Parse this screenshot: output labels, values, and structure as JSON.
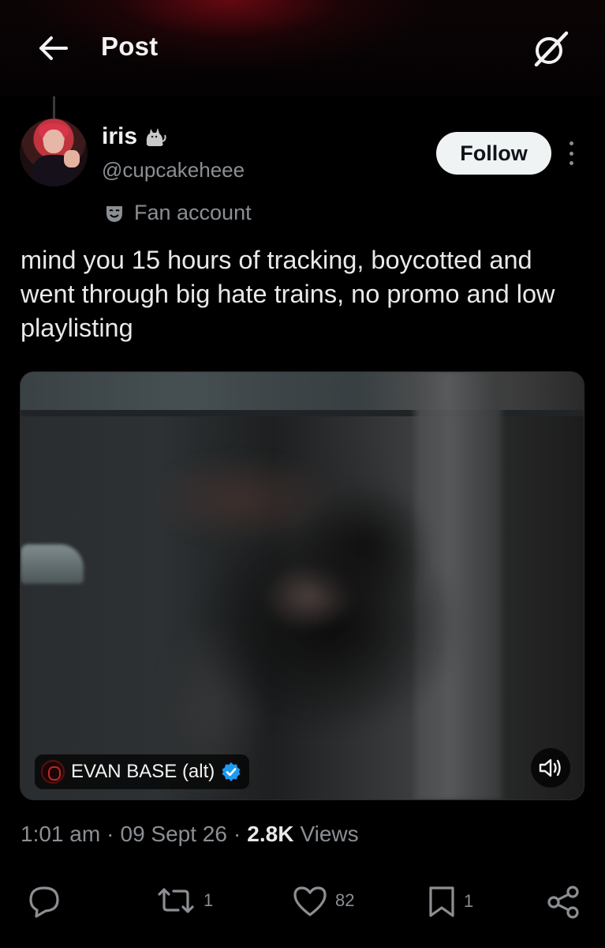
{
  "header": {
    "title": "Post",
    "back_icon": "arrow-left-icon",
    "grok_icon": "grok-icon"
  },
  "author": {
    "name": "iris",
    "name_emoji_icon": "cat-icon",
    "handle": "@cupcakeheee",
    "avatar_icon": "avatar",
    "label_icon": "mask-icon",
    "label": "Fan account"
  },
  "follow_button": {
    "label": "Follow"
  },
  "more_icon": "more-vertical-icon",
  "post": {
    "text": "mind you 15 hours of tracking, boycotted and went through big hate trains, no promo and low playlisting"
  },
  "media": {
    "source_name": "EVAN BASE (alt)",
    "verified_icon": "verified-badge-icon",
    "sound_icon": "speaker-icon"
  },
  "meta": {
    "time": "1:01 am",
    "separator": "·",
    "date": "09 Sept 26",
    "views_count": "2.8K",
    "views_label": "Views"
  },
  "actions": {
    "reply_count": "",
    "repost_count": "1",
    "like_count": "82",
    "bookmark_count": "1"
  },
  "colors": {
    "background": "#000000",
    "text_primary": "#e7e9ea",
    "text_secondary": "#8b8f93",
    "follow_bg": "#eff3f4",
    "verified_blue": "#1d9bf0",
    "header_glow": "#820a14"
  }
}
